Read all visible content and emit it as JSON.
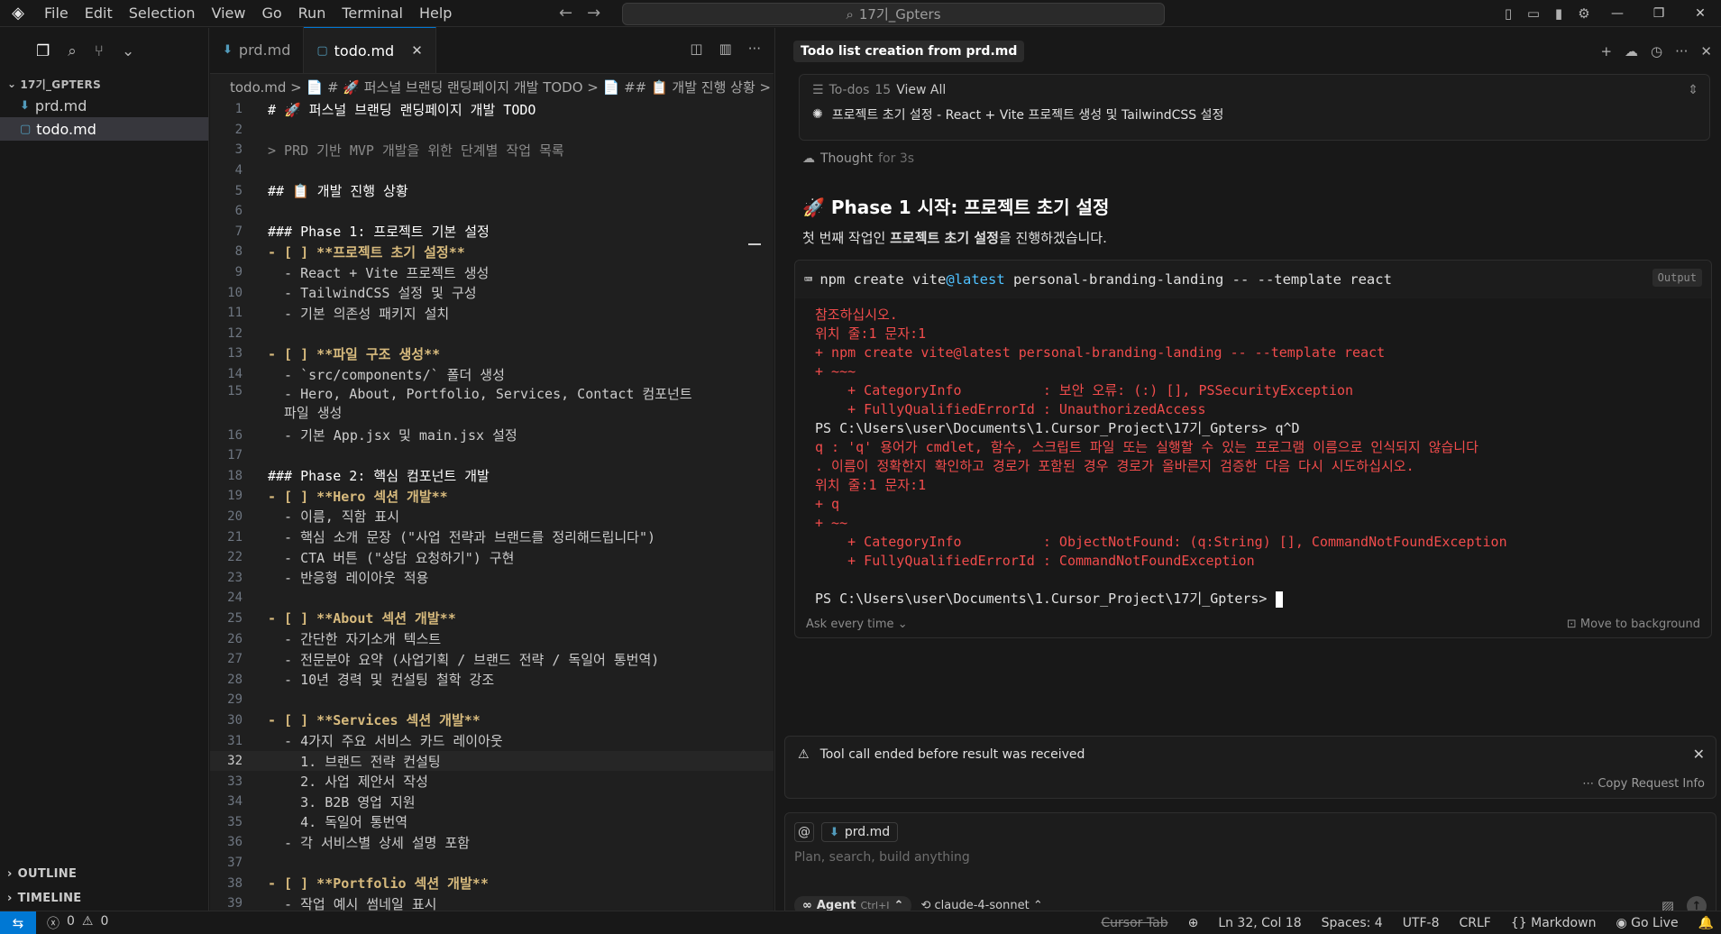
{
  "titlebar": {
    "menu": [
      "File",
      "Edit",
      "Selection",
      "View",
      "Go",
      "Run",
      "Terminal",
      "Help"
    ],
    "search": "17기_Gpters"
  },
  "explorer": {
    "section": "17기_GPTERS",
    "files": [
      "prd.md",
      "todo.md"
    ],
    "outline": "OUTLINE",
    "timeline": "TIMELINE"
  },
  "editor": {
    "tabs": [
      "prd.md",
      "todo.md"
    ],
    "breadcrumb": "todo.md > 📄 # 🚀 퍼스널 브랜딩 랜딩페이지 개발 TODO > 📄 ## 📋 개발 진행 상황 >",
    "lines": [
      {
        "n": "1",
        "t": "# 🚀 퍼스널 브랜딩 랜딩페이지 개발 TODO",
        "s": "c-h"
      },
      {
        "n": "2",
        "t": "",
        "s": ""
      },
      {
        "n": "3",
        "t": "> PRD 기반 MVP 개발을 위한 단계별 작업 목록",
        "s": "c-dim"
      },
      {
        "n": "4",
        "t": "",
        "s": ""
      },
      {
        "n": "5",
        "t": "## 📋 개발 진행 상황",
        "s": "c-h"
      },
      {
        "n": "6",
        "t": "",
        "s": ""
      },
      {
        "n": "7",
        "t": "### Phase 1: 프로젝트 기본 설정",
        "s": "c-h"
      },
      {
        "n": "8",
        "t": "- [ ] **프로젝트 초기 설정**",
        "s": "c-b"
      },
      {
        "n": "9",
        "t": "  - React + Vite 프로젝트 생성",
        "s": ""
      },
      {
        "n": "10",
        "t": "  - TailwindCSS 설정 및 구성",
        "s": ""
      },
      {
        "n": "11",
        "t": "  - 기본 의존성 패키지 설치",
        "s": ""
      },
      {
        "n": "12",
        "t": "",
        "s": ""
      },
      {
        "n": "13",
        "t": "- [ ] **파일 구조 생성**",
        "s": "c-b"
      },
      {
        "n": "14",
        "t": "  - `src/components/` 폴더 생성",
        "s": ""
      },
      {
        "n": "15",
        "t": "  - Hero, About, Portfolio, Services, Contact 컴포넌트\n  파일 생성",
        "s": "",
        "dbl": true
      },
      {
        "n": "16",
        "t": "  - 기본 App.jsx 및 main.jsx 설정",
        "s": ""
      },
      {
        "n": "17",
        "t": "",
        "s": ""
      },
      {
        "n": "18",
        "t": "### Phase 2: 핵심 컴포넌트 개발",
        "s": "c-h"
      },
      {
        "n": "19",
        "t": "- [ ] **Hero 섹션 개발**",
        "s": "c-b"
      },
      {
        "n": "20",
        "t": "  - 이름, 직함 표시",
        "s": ""
      },
      {
        "n": "21",
        "t": "  - 핵심 소개 문장 (\"사업 전략과 브랜드를 정리해드립니다\")",
        "s": ""
      },
      {
        "n": "22",
        "t": "  - CTA 버튼 (\"상담 요청하기\") 구현",
        "s": ""
      },
      {
        "n": "23",
        "t": "  - 반응형 레이아웃 적용",
        "s": ""
      },
      {
        "n": "24",
        "t": "",
        "s": ""
      },
      {
        "n": "25",
        "t": "- [ ] **About 섹션 개발**",
        "s": "c-b"
      },
      {
        "n": "26",
        "t": "  - 간단한 자기소개 텍스트",
        "s": ""
      },
      {
        "n": "27",
        "t": "  - 전문분야 요약 (사업기획 / 브랜드 전략 / 독일어 통번역)",
        "s": ""
      },
      {
        "n": "28",
        "t": "  - 10년 경력 및 컨설팅 철학 강조",
        "s": ""
      },
      {
        "n": "29",
        "t": "",
        "s": ""
      },
      {
        "n": "30",
        "t": "- [ ] **Services 섹션 개발**",
        "s": "c-b"
      },
      {
        "n": "31",
        "t": "  - 4가지 주요 서비스 카드 레이아웃",
        "s": ""
      },
      {
        "n": "32",
        "t": "    1. 브랜드 전략 컨설팅",
        "s": "",
        "cur": true
      },
      {
        "n": "33",
        "t": "    2. 사업 제안서 작성",
        "s": ""
      },
      {
        "n": "34",
        "t": "    3. B2B 영업 지원",
        "s": ""
      },
      {
        "n": "35",
        "t": "    4. 독일어 통번역",
        "s": ""
      },
      {
        "n": "36",
        "t": "  - 각 서비스별 상세 설명 포함",
        "s": ""
      },
      {
        "n": "37",
        "t": "",
        "s": ""
      },
      {
        "n": "38",
        "t": "- [ ] **Portfolio 섹션 개발**",
        "s": "c-b"
      },
      {
        "n": "39",
        "t": "  - 작업 예시 썸네일 표시",
        "s": ""
      }
    ]
  },
  "chat": {
    "title": "Todo list creation from prd.md",
    "todo_label": "To-dos",
    "todo_count": "15",
    "todo_view_all": "View All",
    "todo_current": "프로젝트 초기 설정 - React + Vite 프로젝트 생성 및 TailwindCSS 설정",
    "thought": "Thought",
    "thought_time": "for 3s",
    "phase_title": "🚀 Phase 1 시작: 프로젝트 초기 설정",
    "phase_desc_pre": "첫 번째 작업인 ",
    "phase_desc_bold": "프로젝트 초기 설정",
    "phase_desc_post": "을 진행하겠습니다.",
    "cmd_pre": "npm create vite",
    "cmd_at": "@latest",
    "cmd_post": " personal-branding-landing -- --template react",
    "output_label": "Output",
    "terminal_lines": [
      {
        "t": "참조하십시오.",
        "c": "r"
      },
      {
        "t": "위치 줄:1 문자:1",
        "c": "r"
      },
      {
        "t": "+ npm create vite@latest personal-branding-landing -- --template react",
        "c": "r"
      },
      {
        "t": "+ ~~~",
        "c": "r"
      },
      {
        "t": "    + CategoryInfo          : 보안 오류: (:) [], PSSecurityException",
        "c": "r"
      },
      {
        "t": "    + FullyQualifiedErrorId : UnauthorizedAccess",
        "c": "r"
      },
      {
        "t": "PS C:\\Users\\user\\Documents\\1.Cursor_Project\\17기_Gpters> q^D",
        "c": "w"
      },
      {
        "t": "q : 'q' 용어가 cmdlet, 함수, 스크립트 파일 또는 실행할 수 있는 프로그램 이름으로 인식되지 않습니다",
        "c": "r"
      },
      {
        "t": ". 이름이 정확한지 확인하고 경로가 포함된 경우 경로가 올바른지 검증한 다음 다시 시도하십시오.",
        "c": "r"
      },
      {
        "t": "위치 줄:1 문자:1",
        "c": "r"
      },
      {
        "t": "+ q",
        "c": "r"
      },
      {
        "t": "+ ~~",
        "c": "r"
      },
      {
        "t": "    + CategoryInfo          : ObjectNotFound: (q:String) [], CommandNotFoundException",
        "c": "r"
      },
      {
        "t": "    + FullyQualifiedErrorId : CommandNotFoundException",
        "c": "r"
      },
      {
        "t": "",
        "c": "w"
      }
    ],
    "prompt_line": "PS C:\\Users\\user\\Documents\\1.Cursor_Project\\17기_Gpters> ",
    "ask_every_time": "Ask every time",
    "move_to_background": "Move to background",
    "warning": "Tool call ended before result was received",
    "copy_request": "Copy Request Info",
    "context_file": "prd.md",
    "input_placeholder": "Plan, search, build anything",
    "agent_label": "Agent",
    "agent_shortcut": "Ctrl+I",
    "model": "claude-4-sonnet"
  },
  "status": {
    "errors": "0",
    "warnings": "0",
    "cursor_tab": "Cursor Tab",
    "position": "Ln 32, Col 18",
    "spaces": "Spaces: 4",
    "encoding": "UTF-8",
    "eol": "CRLF",
    "language": "Markdown",
    "go_live": "Go Live"
  }
}
